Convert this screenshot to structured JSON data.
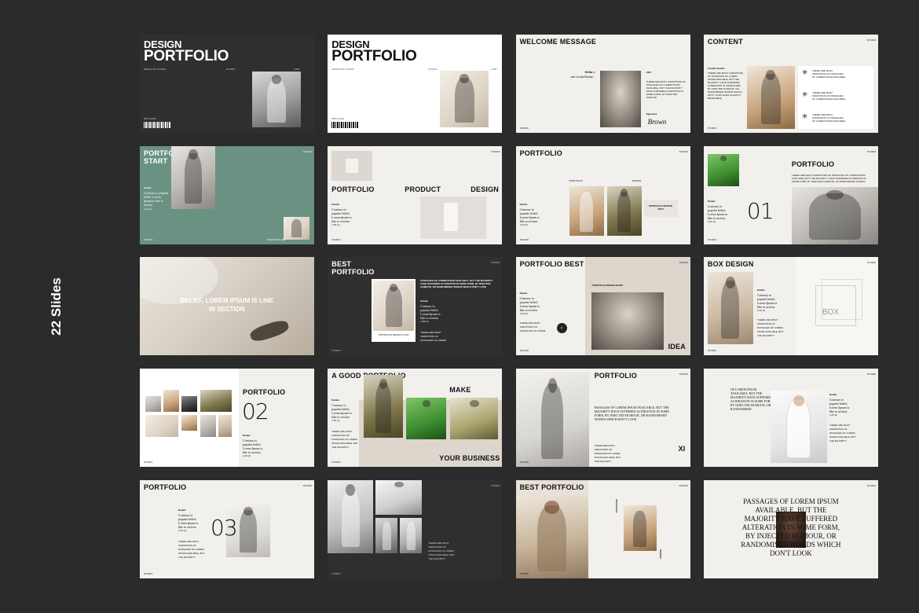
{
  "side_label": "22 Slides",
  "slides": {
    "s1": {
      "title_line1": "DESIGN",
      "title_line2": "PORTFOLIO",
      "sub": "DESIGN BY STUDIO",
      "studio": "STUDIO",
      "year": "2.057",
      "code": "8870 12034"
    },
    "s2": {
      "title_line1": "DESIGN",
      "title_line2": "PORTFOLIO",
      "sub": "DESIGN BY STUDIO",
      "studio": "STUDIO",
      "year": "2.057",
      "code": "8870 12034"
    },
    "s3": {
      "title": "WELCOME MESSAGE",
      "hello": "Hello I,",
      "name": "am Linda Brown",
      "role": "CEO",
      "body": "THERE ARE MANY VARIATIONS OF PASSAGES OF LOREM IPSUM AVAILABLE, BUT THE MAJORITY HAVE SUFFERED ALTERATION IN SOME FORM, BY INJECTED HUMOUR",
      "signature_label": "Signature",
      "signature": "Brown",
      "studio": "STUDIO"
    },
    "s4": {
      "title": "CONTENT",
      "corner": "STUDIO",
      "details": "Content Details",
      "body": "THERE ARE MANY VARIATIONS OF PASSAGES OF LOREM IPSUM AVAILABLE, BUT THE MAJORITY HAVE SUFFERED ALTERATION IN SOME FORM, BY INJECTED HUMOUR, OR RANDOMISED WORDS WHICH DON'T LOOK EVEN SLIGHTLY BELIEVABLE",
      "items": [
        "THERE ARE MANY VARIATIONS OF PASSAGES OF LOREM IPSUM AVAILABLE",
        "THERE ARE MANY VARIATIONS OF PASSAGES OF LOREM IPSUM AVAILABLE",
        "THERE ARE MANY VARIATIONS OF PASSAGES OF LOREM IPSUM AVAILABLE"
      ],
      "studio": "STUDIO"
    },
    "s5": {
      "title_line1": "PORTFOLIO",
      "title_line2": "START",
      "corner": "STUDIO",
      "details": "Details",
      "body": "Contrary to popular belief, Lorem Ipsum is like to section",
      "num": "1.00 (1)",
      "studio": "STUDIO",
      "caption": "PORTFOLIO SET"
    },
    "s6": {
      "top_label": "PORTFOLIO",
      "corner": "STUDIO",
      "w1": "PORTFOLIO",
      "w2": "PRODUCT",
      "w3": "DESIGN",
      "details": "Details",
      "body": "Contrary to popular belief, Lorem Ipsum is like to section",
      "num": "1.00 (1)",
      "studio": "STUDIO"
    },
    "s7": {
      "title": "PORTFOLIO",
      "corner": "STUDIO",
      "label1": "PORTFOLIO",
      "label2": "DESIGN",
      "details": "Details",
      "body": "Contrary to popular belief, Lorem Ipsum is like to section",
      "num": "1.00 (1)",
      "card": "PORTFOLIO DESIGN TEXT",
      "studio": "STUDIO"
    },
    "s8": {
      "title": "PORTFOLIO",
      "corner": "STUDIO",
      "body": "THERE ARE MANY VARIATIONS OF PASSAGES OF LOREM IPSUM AVAILABLE, BUT THE MAJORITY HAVE SUFFERED ALTERATION IN SOME FORM, BY INJECTED HUMOUR, OR RANDOMISED WORDS",
      "number": "01",
      "details": "Details",
      "small_body": "Contrary to popular belief, Lorem Ipsum is like to section",
      "num": "1.00 (1)",
      "studio": "STUDIO"
    },
    "s9": {
      "line1": "BELIEF, LOREM IPSUM IS LINE",
      "line2": "IN SECTION"
    },
    "s10": {
      "title_line1": "BEST",
      "title_line2": "PORTFOLIO",
      "corner": "STUDIO",
      "body": "PASSAGES OF LOREM IPSUM AVAILABLE, BUT THE MAJORITY HAVE SUFFERED ALTERATION IN SOME FORM, BY INJECTED HUMOUR, OR RANDOMISED WORDS WHICH DON'T LOOK",
      "details": "Details",
      "small_body": "Contrary to popular belief, Lorem Ipsum is like to section",
      "num": "1.00 (1)",
      "card": "PORTFOLIO DESIGN LOOK",
      "list": [
        "THERE ARE MANY",
        "VARIATIONS OF",
        "PASSAGES OF LOREM",
        "IPSUM AVAILABLE, BUT",
        "THE MAJORITY"
      ],
      "studio": "STUDIO"
    },
    "s11": {
      "title": "PORTFOLIO BEST",
      "corner": "STUDIO",
      "details": "Details",
      "body": "Contrary to popular belief, Lorem Ipsum is like to section",
      "num": "1.00 (1)",
      "card": "PORTFOLIO DESIGN BOOK",
      "idea": "IDEA",
      "list": [
        "THERE ARE MANY",
        "VARIATIONS OF",
        "PASSAGES OF LOREM",
        "IPSUM AVAILABLE, BUT",
        "THE MAJORITY"
      ],
      "studio": "STUDIO"
    },
    "s12": {
      "title": "BOX DESIGN",
      "corner": "STUDIO",
      "details": "Details",
      "body": "Contrary to popular belief, Lorem Ipsum is like to section",
      "num": "1.00 (1)",
      "box": "BOX",
      "list": [
        "THERE ARE MANY",
        "VARIATIONS OF",
        "PASSAGES OF LOREM",
        "IPSUM AVAILABLE, BUT",
        "THE MAJORITY"
      ],
      "studio": "STUDIO"
    },
    "s13": {
      "title": "PORTFOLIO",
      "number": "02",
      "details": "Details",
      "body": "Contrary to popular belief, Lorem Ipsum is like to section",
      "num": "1.00 (1)",
      "studio": "STUDIO"
    },
    "s14": {
      "title": "A GOOD PORTFOLIO",
      "make": "MAKE",
      "your_business": "YOUR BUSINESS",
      "details": "Details",
      "body": "Contrary to popular belief, Lorem Ipsum is like to section",
      "num": "1.00 (1)",
      "list": [
        "THERE ARE MANY",
        "VARIATIONS OF",
        "PASSAGES OF LOREM",
        "IPSUM AVAILABLE, BUT",
        "THE MAJORITY"
      ],
      "studio": "STUDIO"
    },
    "s15": {
      "title": "PORTFOLIO",
      "corner": "STUDIO",
      "body": "PASSAGES OF LOREM IPSUM AVAILABLE, BUT THE MAJORITY HAVE SUFFERED ALTERATION IN SOME FORM, BY INJECTED HUMOUR, OR RANDOMISED WORDS WHICH DON'T LOOK",
      "xi": "XI",
      "list": [
        "THERE ARE MANY",
        "VARIATIONS OF",
        "PASSAGES OF LOREM",
        "IPSUM AVAILABLE, BUT",
        "THE MAJORITY"
      ],
      "studio": "STUDIO"
    },
    "s16": {
      "body": "OF LOREM IPSUM AVAILABLE, BUT THE MAJORITY HAVE SUFFERED ALTERATION IN SOME FORM, BY INJECTED HUMOUR, OR RANDOMISED",
      "corner": "STUDIO",
      "details": "Details",
      "small_body": "Contrary to popular belief, Lorem Ipsum is like to section",
      "num": "1.00 (1)",
      "list": [
        "THERE ARE MANY",
        "VARIATIONS OF",
        "PASSAGES OF LOREM",
        "IPSUM AVAILABLE, BUT",
        "THE MAJORITY"
      ]
    },
    "s17": {
      "title": "PORTFOLIO",
      "corner": "STUDIO",
      "details": "Details",
      "body": "Contrary to popular belief, Lorem Ipsum is like to section",
      "num": "1.00 (1)",
      "number": "03",
      "list": [
        "THERE ARE MANY",
        "VARIATIONS OF",
        "PASSAGES OF LOREM",
        "IPSUM AVAILABLE, BUT",
        "THE MAJORITY"
      ],
      "studio": "STUDIO"
    },
    "s18": {
      "corner": "STUDIO",
      "list": [
        "THERE ARE MANY",
        "VARIATIONS OF",
        "PASSAGES OF LOREM",
        "IPSUM AVAILABLE, BUT",
        "THE MAJORITY"
      ],
      "studio": "STUDIO"
    },
    "s19": {
      "title": "BEST PORTFOLIO",
      "corner": "STUDIO",
      "vertical": "PORTFOLIO",
      "small": "DESIGN",
      "studio": "STUDIO"
    },
    "s20": {
      "lines": [
        "PASSAGES OF LOREM IPSUM",
        "AVAILABLE, BUT THE",
        "MAJORITY HAVE SUFFERED",
        "ALTERATION IN SOME FORM,",
        "BY INJECTED HUMOUR, OR",
        "RANDOMISED WORDS WHICH",
        "DON'T LOOK"
      ],
      "corner": "STUDIO"
    }
  }
}
